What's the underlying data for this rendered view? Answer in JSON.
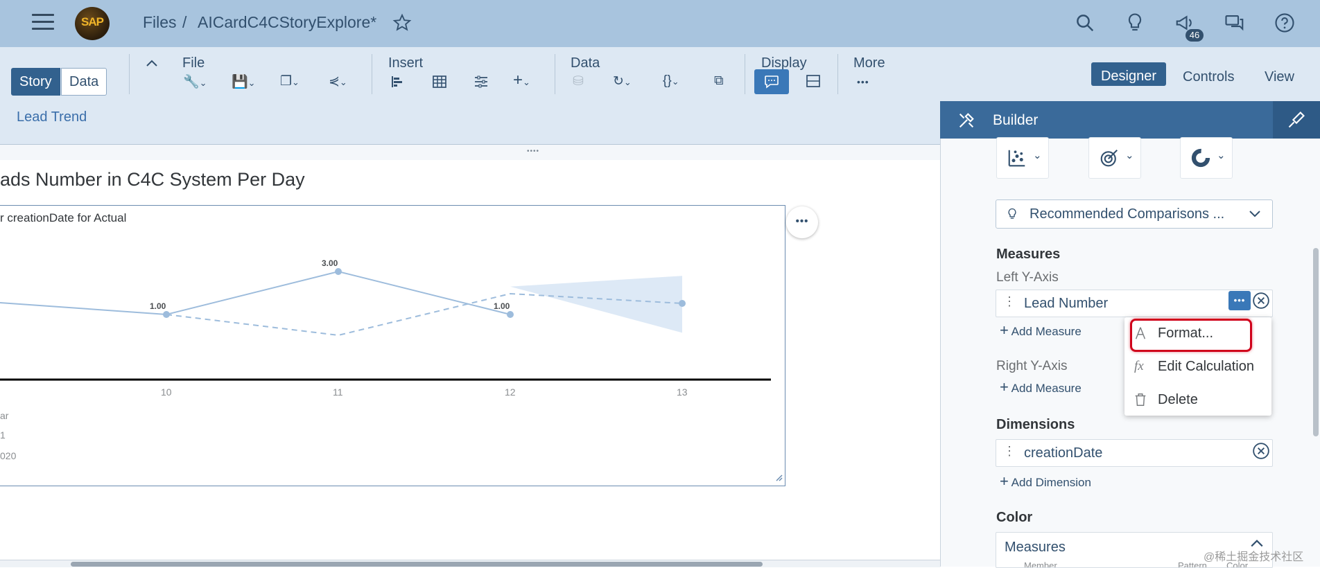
{
  "shell": {
    "breadcrumb_root": "Files",
    "breadcrumb_sep": "/",
    "breadcrumb_file": "AICardC4CStoryExplore*",
    "logo_text": "SAP",
    "notification_count": "46",
    "icons": [
      "menu-icon",
      "search-icon",
      "lightbulb-icon",
      "megaphone-icon",
      "chat-icon",
      "help-icon",
      "star-icon"
    ]
  },
  "toolbar": {
    "story_label": "Story",
    "data_label": "Data",
    "file_label": "File",
    "insert_label": "Insert",
    "data_group_label": "Data",
    "display_label": "Display",
    "more_label": "More",
    "designer_label": "Designer",
    "controls_label": "Controls",
    "view_label": "View",
    "page_tab": "Lead Trend",
    "accent_color": "#32618e"
  },
  "chart": {
    "title": "ads Number in C4C System Per Day",
    "subtitle": "r creationDate for Actual",
    "legend_lines": [
      "ar",
      "1",
      "020"
    ],
    "more_label": "•••"
  },
  "chart_data": {
    "type": "line",
    "x": [
      "10",
      "11",
      "12",
      "13"
    ],
    "series": [
      {
        "values": [
          1.0,
          3.0,
          1.0,
          null
        ],
        "labels": [
          "1.00",
          "3.00",
          "1.00",
          ""
        ]
      }
    ],
    "forecast_present": true,
    "data_labels": [
      "1.00",
      "3.00",
      "1.00"
    ],
    "line_color": "#9dbcdc",
    "forecast_band_color": "#dde9f6"
  },
  "builder": {
    "title": "Builder",
    "recommended": "Recommended Comparisons ...",
    "measures_title": "Measures",
    "left_axis": "Left Y-Axis",
    "measure_field": "Lead Number",
    "add_measure_1": "Add Measure",
    "right_axis": "Right Y-Axis",
    "add_measure_2": "Add Measure",
    "dimensions_title": "Dimensions",
    "dimension_field": "creationDate",
    "add_dimension": "Add Dimension",
    "color_title": "Color",
    "color_field": "Measures",
    "color_col1": "Member",
    "color_col2": "Pattern",
    "color_col3": "Color"
  },
  "context_menu": {
    "items": [
      {
        "label": "Format...",
        "icon": "format-icon"
      },
      {
        "label": "Edit Calculation",
        "icon": "fx-icon"
      },
      {
        "label": "Delete",
        "icon": "trash-icon"
      }
    ],
    "highlight_color": "#d0021b"
  },
  "watermark": "@稀土掘金技术社区"
}
